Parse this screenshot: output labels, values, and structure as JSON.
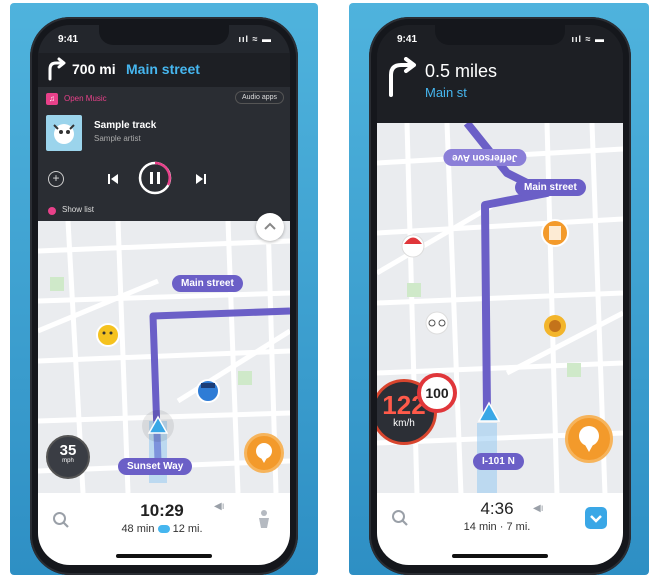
{
  "left_phone": {
    "status_time": "9:41",
    "status_icons": "ııl ≈ ▬",
    "nav": {
      "distance": "700 mi",
      "street": "Main street"
    },
    "music": {
      "app_label": "Open Music",
      "audio_apps": "Audio apps",
      "track_title": "Sample track",
      "track_artist": "Sample artist",
      "show_list": "Show list"
    },
    "map_labels": {
      "street": "Main street",
      "current_road": "Sunset Way"
    },
    "speed": {
      "value": "35",
      "unit": "mph"
    },
    "eta": {
      "time": "10:29",
      "duration": "48 min",
      "distance": "12 mi."
    }
  },
  "right_phone": {
    "status_time": "9:41",
    "status_icons": "ııl ≈ ▬",
    "nav": {
      "distance": "0.5 miles",
      "street": "Main st"
    },
    "map_labels": {
      "top_street": "Jefferson Ave",
      "street": "Main street",
      "current_road": "I-101 N"
    },
    "speed": {
      "value": "122",
      "unit": "km/h",
      "limit": "100"
    },
    "eta": {
      "time": "4:36",
      "duration": "14 min",
      "distance": "7 mi."
    }
  },
  "colors": {
    "route": "#6b5fc7",
    "accent_pink": "#e8418a",
    "panel_blue": "#3ea0d3",
    "orange_pin": "#f39a2b",
    "nav_bg": "#1d1f24"
  }
}
